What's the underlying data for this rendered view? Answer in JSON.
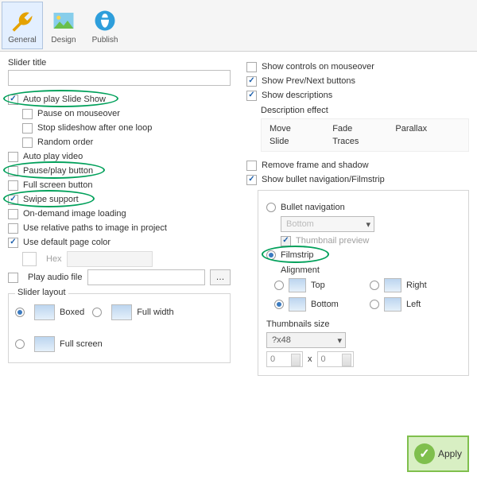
{
  "toolbar": {
    "general_label": "General",
    "design_label": "Design",
    "publish_label": "Publish"
  },
  "left": {
    "slider_title_label": "Slider title",
    "slider_title_value": "",
    "autoplay": "Auto play Slide Show",
    "pause_mouseover": "Pause on mouseover",
    "stop_one_loop": "Stop slideshow after one loop",
    "random_order": "Random order",
    "auto_play_video": "Auto play video",
    "pause_play_button": "Pause/play button",
    "fullscreen_button": "Full screen button",
    "swipe_support": "Swipe support",
    "ondemand_loading": "On-demand image loading",
    "use_relative_paths": "Use relative paths to image in project",
    "use_default_color": "Use default page color",
    "hex_label": "Hex",
    "play_audio_label": "Play audio file",
    "audio_value": "",
    "layout_title": "Slider layout",
    "layout_boxed": "Boxed",
    "layout_fullwidth": "Full width",
    "layout_fullscreen": "Full screen"
  },
  "right": {
    "show_controls": "Show controls on mouseover",
    "show_prevnext": "Show Prev/Next buttons",
    "show_descriptions": "Show descriptions",
    "desc_effect_label": "Description effect",
    "desc_effects": [
      "Move",
      "Fade",
      "Parallax",
      "Slide",
      "Traces"
    ],
    "remove_frame": "Remove frame and shadow",
    "show_bullet_nav": "Show bullet navigation/Filmstrip",
    "bullet_nav": "Bullet navigation",
    "bullet_pos_value": "Bottom",
    "thumbnail_preview": "Thumbnail preview",
    "filmstrip": "Filmstrip",
    "alignment_label": "Alignment",
    "align_top": "Top",
    "align_right": "Right",
    "align_bottom": "Bottom",
    "align_left": "Left",
    "thumbs_size_label": "Thumbnails size",
    "thumbs_size_value": "?x48",
    "thumbs_w": "0",
    "thumbs_x": "x",
    "thumbs_h": "0"
  },
  "apply_label": "Apply"
}
